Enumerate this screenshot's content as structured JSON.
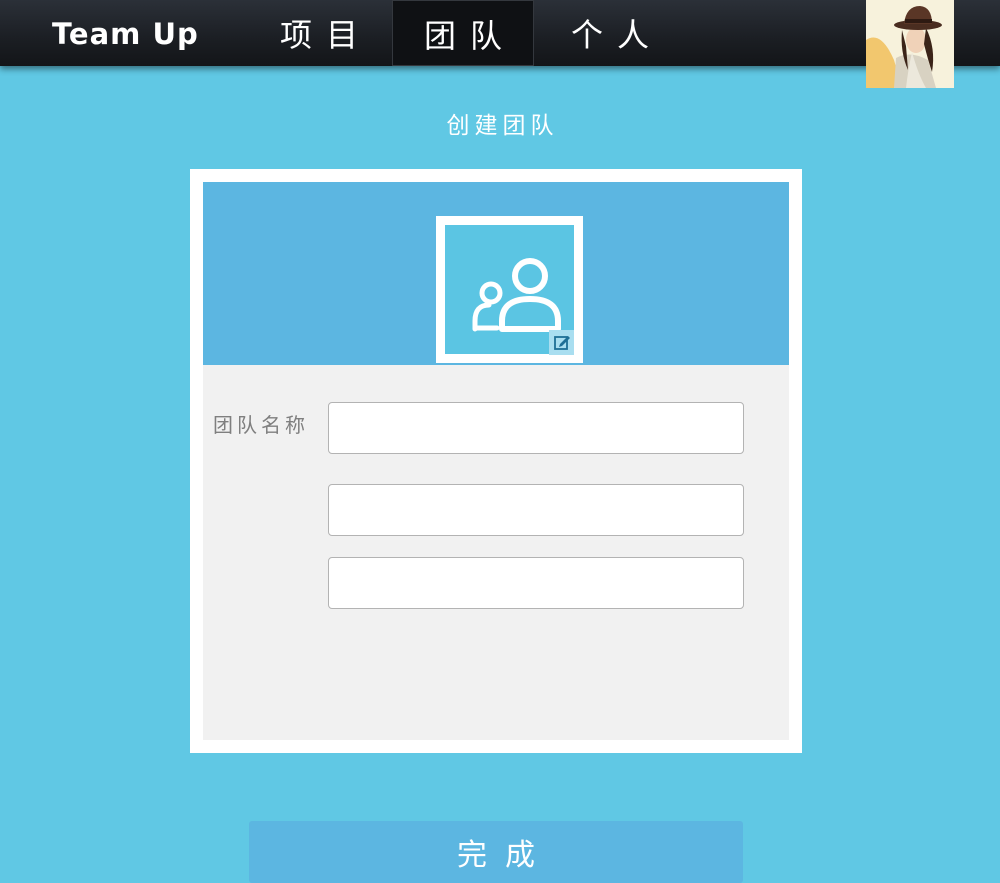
{
  "header": {
    "brand": "Team Up",
    "tabs": [
      {
        "label": "项目",
        "active": false
      },
      {
        "label": "团队",
        "active": true
      },
      {
        "label": "个人",
        "active": false
      }
    ],
    "avatar_icon": "user-avatar-photo"
  },
  "page": {
    "title": "创建团队"
  },
  "form": {
    "team_avatar_icon": "team-group-icon",
    "edit_icon": "edit-icon",
    "name_label": "团队名称",
    "name_value": "",
    "extra_field_1_value": "",
    "extra_field_2_value": "",
    "submit_label": "完成"
  },
  "colors": {
    "background": "#60c8e4",
    "header_panel": "#5cb6e1",
    "button": "#5cb6e1",
    "topbar": "#1b1e23"
  }
}
